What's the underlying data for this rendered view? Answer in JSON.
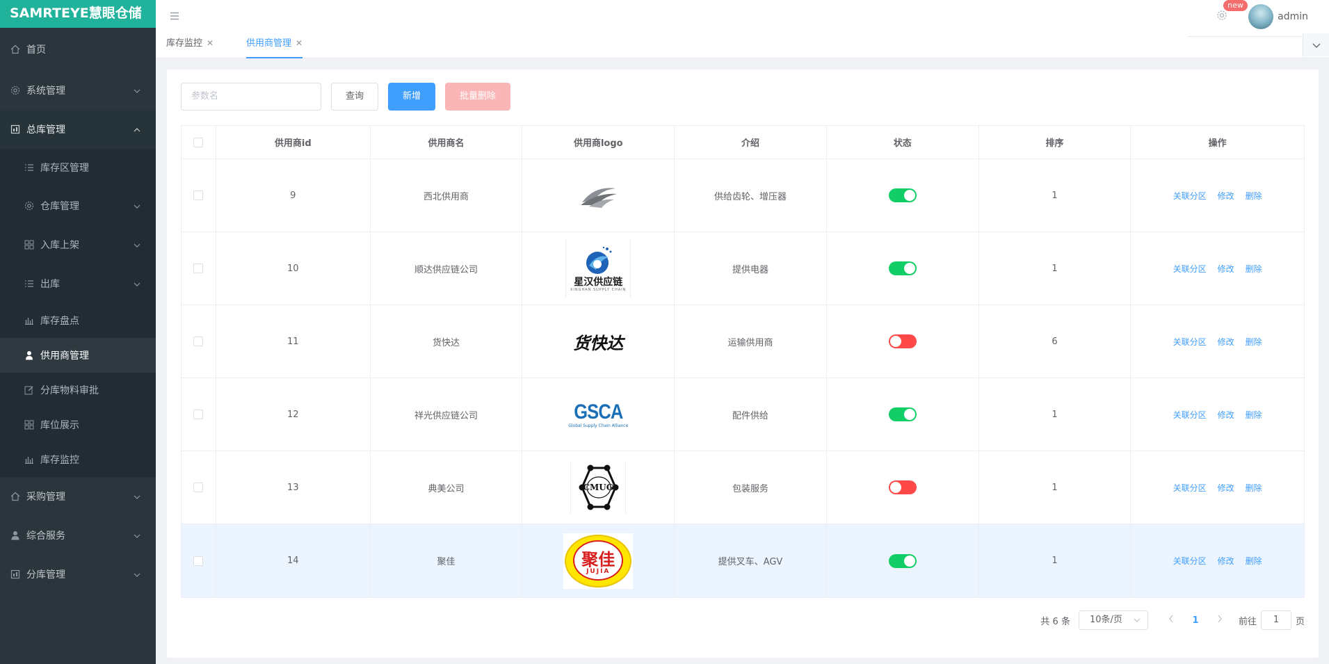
{
  "app": {
    "brand": "SAMRTEYE慧眼仓储"
  },
  "header": {
    "badge": "new",
    "user": "admin"
  },
  "tabs": [
    {
      "label": "库存监控",
      "active": false
    },
    {
      "label": "供用商管理",
      "active": true
    }
  ],
  "sidebar": {
    "items": [
      {
        "label": "首页",
        "icon": "home-icon"
      },
      {
        "label": "系统管理",
        "icon": "gear-icon"
      },
      {
        "label": "总库管理",
        "icon": "warehouse-icon"
      },
      {
        "label": "库存区管理",
        "icon": "list-icon"
      },
      {
        "label": "仓库管理",
        "icon": "gear-icon"
      },
      {
        "label": "入库上架",
        "icon": "grid-icon"
      },
      {
        "label": "出库",
        "icon": "list-icon"
      },
      {
        "label": "库存盘点",
        "icon": "bar-chart-icon"
      },
      {
        "label": "供用商管理",
        "icon": "person-icon"
      },
      {
        "label": "分库物料审批",
        "icon": "edit-icon"
      },
      {
        "label": "库位展示",
        "icon": "grid-icon"
      },
      {
        "label": "库存监控",
        "icon": "bar-chart-icon"
      },
      {
        "label": "采购管理",
        "icon": "home-icon"
      },
      {
        "label": "综合服务",
        "icon": "user-icon"
      },
      {
        "label": "分库管理",
        "icon": "warehouse-icon"
      }
    ]
  },
  "toolbar": {
    "search_placeholder": "参数名",
    "query": "查询",
    "add": "新增",
    "batch_delete": "批量删除"
  },
  "table": {
    "columns": [
      "供用商id",
      "供用商名",
      "供用商logo",
      "介绍",
      "状态",
      "排序",
      "操作"
    ],
    "actions": [
      "关联分区",
      "修改",
      "删除"
    ],
    "rows": [
      {
        "id": "9",
        "name": "西北供用商",
        "logo": "swoosh-logo",
        "intro": "供给齿轮、增压器",
        "status": true,
        "sort": "1"
      },
      {
        "id": "10",
        "name": "顺达供应链公司",
        "logo": "星汉供应链",
        "intro": "提供电器",
        "status": true,
        "sort": "1"
      },
      {
        "id": "11",
        "name": "货快达",
        "logo": "货快达",
        "intro": "运输供用商",
        "status": false,
        "sort": "6"
      },
      {
        "id": "12",
        "name": "祥光供应链公司",
        "logo": "GSCA",
        "intro": "配件供给",
        "status": true,
        "sort": "1"
      },
      {
        "id": "13",
        "name": "典美公司",
        "logo": "CMUG",
        "intro": "包装服务",
        "status": false,
        "sort": "1"
      },
      {
        "id": "14",
        "name": "聚佳",
        "logo": "聚佳",
        "intro": "提供叉车、AGV",
        "status": true,
        "sort": "1"
      }
    ]
  },
  "logo_text": {
    "xinghan_sub": "XINGHAN SUPPLY CHAIN",
    "gsca_sub": "Global Supply Chain Alliance",
    "jujia_en": "JUJIA"
  },
  "pagination": {
    "total": "共 6 条",
    "page_size": "10条/页",
    "current": "1",
    "goto_prefix": "前往",
    "goto_value": "1",
    "goto_suffix": "页"
  },
  "colors": {
    "brand": "#20b29a",
    "primary": "#409eff",
    "switch_on": "#13ce66",
    "switch_off": "#ff4949",
    "sidebar_bg": "#2b363c"
  }
}
